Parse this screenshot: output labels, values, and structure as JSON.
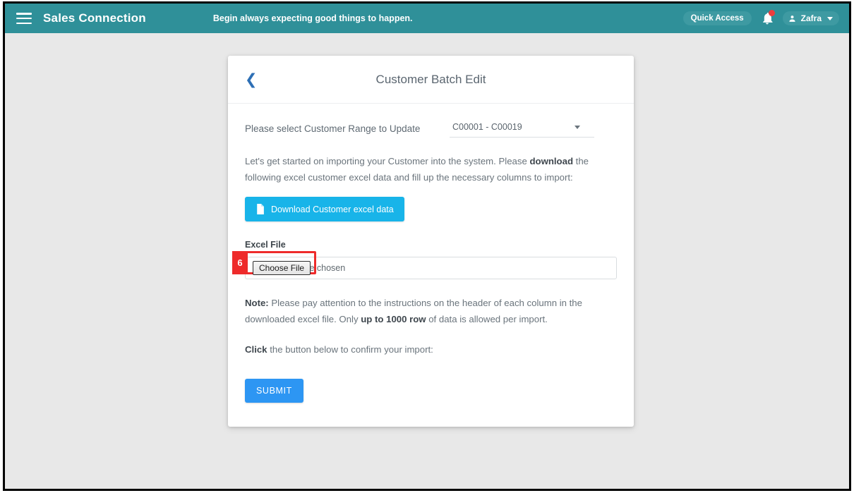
{
  "appbar": {
    "menu_icon": "hamburger-icon",
    "brand": "Sales Connection",
    "tagline": "Begin always expecting good things to happen.",
    "quick_access_label": "Quick Access",
    "bell_icon": "notification-bell-icon",
    "has_notification": true,
    "user_name": "Zafra",
    "user_icon": "person-icon",
    "chevron_icon": "chevron-down-icon",
    "bar_color": "#2f9099",
    "pill_color": "#3e9aa2",
    "badge_color": "#ef3d3d"
  },
  "card": {
    "back_icon": "back-chevron-icon",
    "title": "Customer Batch Edit",
    "range": {
      "label": "Please select Customer Range to Update",
      "selected": "C00001 - C00019",
      "caret_icon": "caret-down-icon"
    },
    "intro": {
      "part1": "Let's get started on importing your Customer into the system. Please ",
      "bold1": "download",
      "part2": " the following excel customer excel data and fill up the necessary columns to import:"
    },
    "download_button": {
      "label": "Download Customer excel data",
      "icon": "file-document-icon",
      "color": "#18b4e9"
    },
    "file_field": {
      "label": "Excel File",
      "choose_button": "Choose File",
      "no_file_text": "No file chosen"
    },
    "note": {
      "bold1": "Note:",
      "part1": " Please pay attention to the instructions on the header of each column in the downloaded excel file. Only ",
      "bold2": "up to 1000 row",
      "part2": " of data is allowed per import."
    },
    "click": {
      "bold1": "Click",
      "part1": " the button below to confirm your import:"
    },
    "submit_button": {
      "label": "SUBMIT",
      "color": "#2d96f3"
    }
  },
  "annotation": {
    "step_number": "6",
    "color": "#ee2b2b",
    "target": "choose-file-button"
  }
}
